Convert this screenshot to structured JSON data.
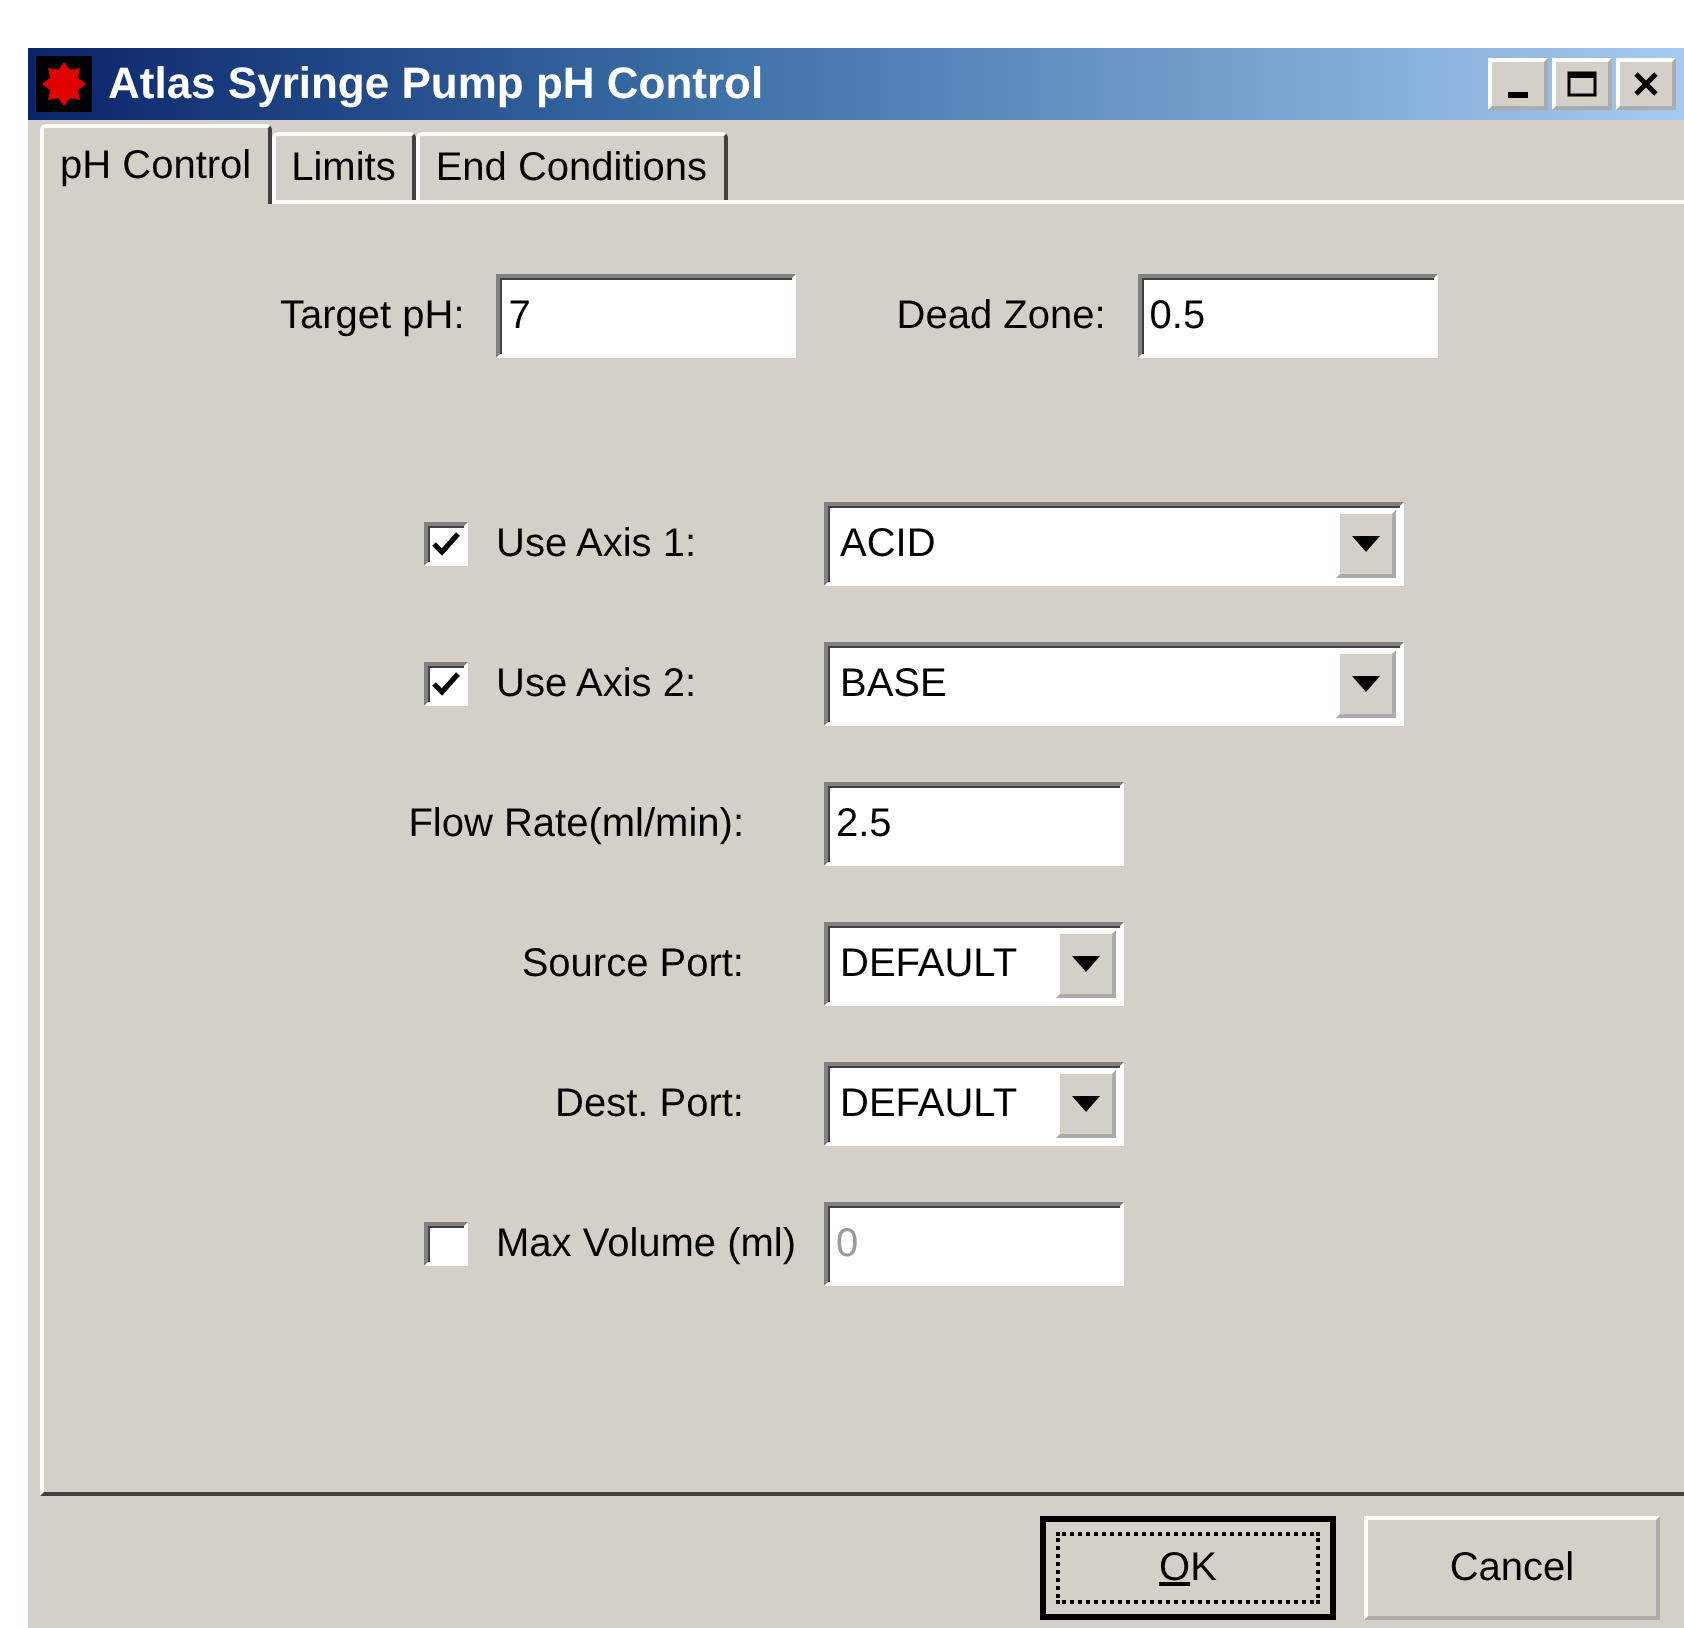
{
  "window": {
    "title": "Atlas Syringe Pump pH Control",
    "controls": [
      {
        "kind": "minimize"
      },
      {
        "kind": "maximize"
      },
      {
        "kind": "close"
      }
    ]
  },
  "tabs": [
    {
      "label": "pH Control",
      "selected": true
    },
    {
      "label": "Limits",
      "selected": false
    },
    {
      "label": "End Conditions",
      "selected": false
    }
  ],
  "top_fields": [
    {
      "label": "Target pH:",
      "value": "7"
    },
    {
      "label": "Dead Zone:",
      "value": "0.5"
    }
  ],
  "rows": [
    {
      "kind": "check-select",
      "label": "Use Axis 1:",
      "checked": true,
      "value": "ACID",
      "wide": true
    },
    {
      "kind": "check-select",
      "label": "Use Axis 2:",
      "checked": true,
      "value": "BASE",
      "wide": true
    },
    {
      "kind": "input",
      "label": "Flow Rate(ml/min):",
      "value": "2.5"
    },
    {
      "kind": "select",
      "label": "Source Port:",
      "value": "DEFAULT"
    },
    {
      "kind": "select",
      "label": "Dest. Port:",
      "value": "DEFAULT"
    },
    {
      "kind": "check-input",
      "label": "Max Volume (ml)",
      "checked": false,
      "value": "0",
      "disabled": true
    }
  ],
  "buttons": [
    {
      "label": "OK",
      "default": true
    },
    {
      "label": "Cancel",
      "default": false
    }
  ]
}
